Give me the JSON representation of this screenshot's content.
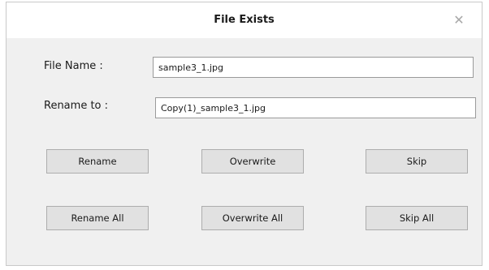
{
  "dialog": {
    "title": "File Exists",
    "close_glyph": "✕"
  },
  "form": {
    "file_name_label": "File Name :",
    "file_name_value": "sample3_1.jpg",
    "rename_to_label": "Rename to :",
    "rename_to_value": "Copy(1)_sample3_1.jpg"
  },
  "buttons": {
    "rename": "Rename",
    "overwrite": "Overwrite",
    "skip": "Skip",
    "rename_all": "Rename All",
    "overwrite_all": "Overwrite All",
    "skip_all": "Skip All"
  }
}
